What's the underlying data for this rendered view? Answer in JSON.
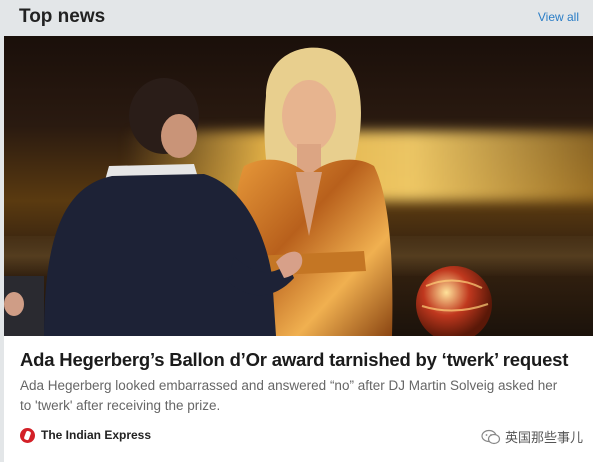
{
  "header": {
    "title": "Top news",
    "view_all": "View all"
  },
  "article": {
    "headline": "Ada Hegerberg’s Ballon d’Or award tarnished by ‘twerk’ request",
    "summary": "Ada Hegerberg looked embarrassed and answered “no” after DJ Martin Solveig asked her to 'twerk' after receiving the prize.",
    "source": "The Indian Express",
    "source_icon": "indian-express-logo",
    "image_alt": "Ada Hegerberg on stage at the Ballon d'Or ceremony"
  },
  "watermark": {
    "text": "英国那些事儿",
    "icon": "wechat-icon"
  },
  "colors": {
    "link": "#2a7dc6",
    "headline": "#1b1b1b",
    "summary": "#666666",
    "source_brand": "#d32027",
    "background": "#e3e6e8"
  }
}
